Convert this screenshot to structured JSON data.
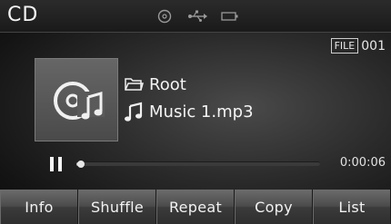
{
  "header": {
    "title": "CD",
    "status_icons": [
      "disc-icon",
      "usb-icon",
      "battery-icon"
    ]
  },
  "file": {
    "badge": "FILE",
    "number": "001"
  },
  "track": {
    "folder_icon": "folder-icon",
    "folder": "Root",
    "music_icon": "music-note-icon",
    "name": "Music 1.mp3"
  },
  "playback": {
    "state_icon": "pause-icon",
    "progress": 0.02,
    "elapsed": "0:00:06"
  },
  "buttons": [
    "Info",
    "Shuffle",
    "Repeat",
    "Copy",
    "List"
  ],
  "colors": {
    "background": "#2a2a2a",
    "title_bar": "#1e1e1e",
    "button": "#4b4b4b",
    "text": "#f2f2f2"
  }
}
